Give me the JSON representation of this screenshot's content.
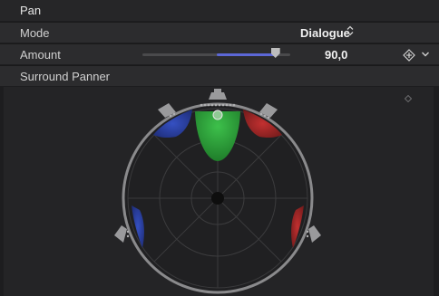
{
  "pan": {
    "title": "Pan"
  },
  "mode": {
    "label": "Mode",
    "value": "Dialogue",
    "chevron": "⌃⌄"
  },
  "amount": {
    "label": "Amount",
    "value": "90,0",
    "fraction": 0.9
  },
  "surround": {
    "label": "Surround Panner"
  },
  "icons": {
    "keyframe": "keyframe-diamond-icon",
    "expand": "chevron-down-icon",
    "mode_updown": "updown-chevron-icon"
  },
  "colors": {
    "center": "#2fa83c",
    "left": "#2b3f9e",
    "right": "#a02424",
    "slider_fill": "#5c67d6"
  }
}
